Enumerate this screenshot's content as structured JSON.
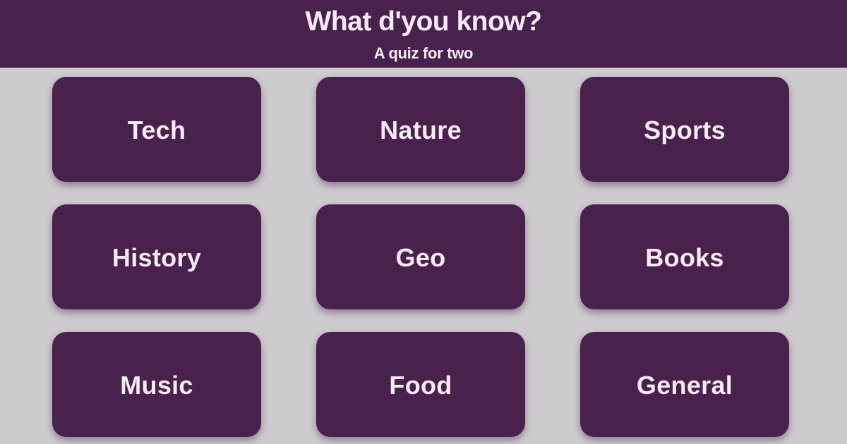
{
  "header": {
    "title": "What d'you know?",
    "subtitle": "A quiz for two"
  },
  "categories": [
    {
      "label": "Tech"
    },
    {
      "label": "Nature"
    },
    {
      "label": "Sports"
    },
    {
      "label": "History"
    },
    {
      "label": "Geo"
    },
    {
      "label": "Books"
    },
    {
      "label": "Music"
    },
    {
      "label": "Food"
    },
    {
      "label": "General"
    }
  ],
  "colors": {
    "primary": "#48214c",
    "background": "#cdcbce",
    "text_light": "#f7eaf5"
  }
}
